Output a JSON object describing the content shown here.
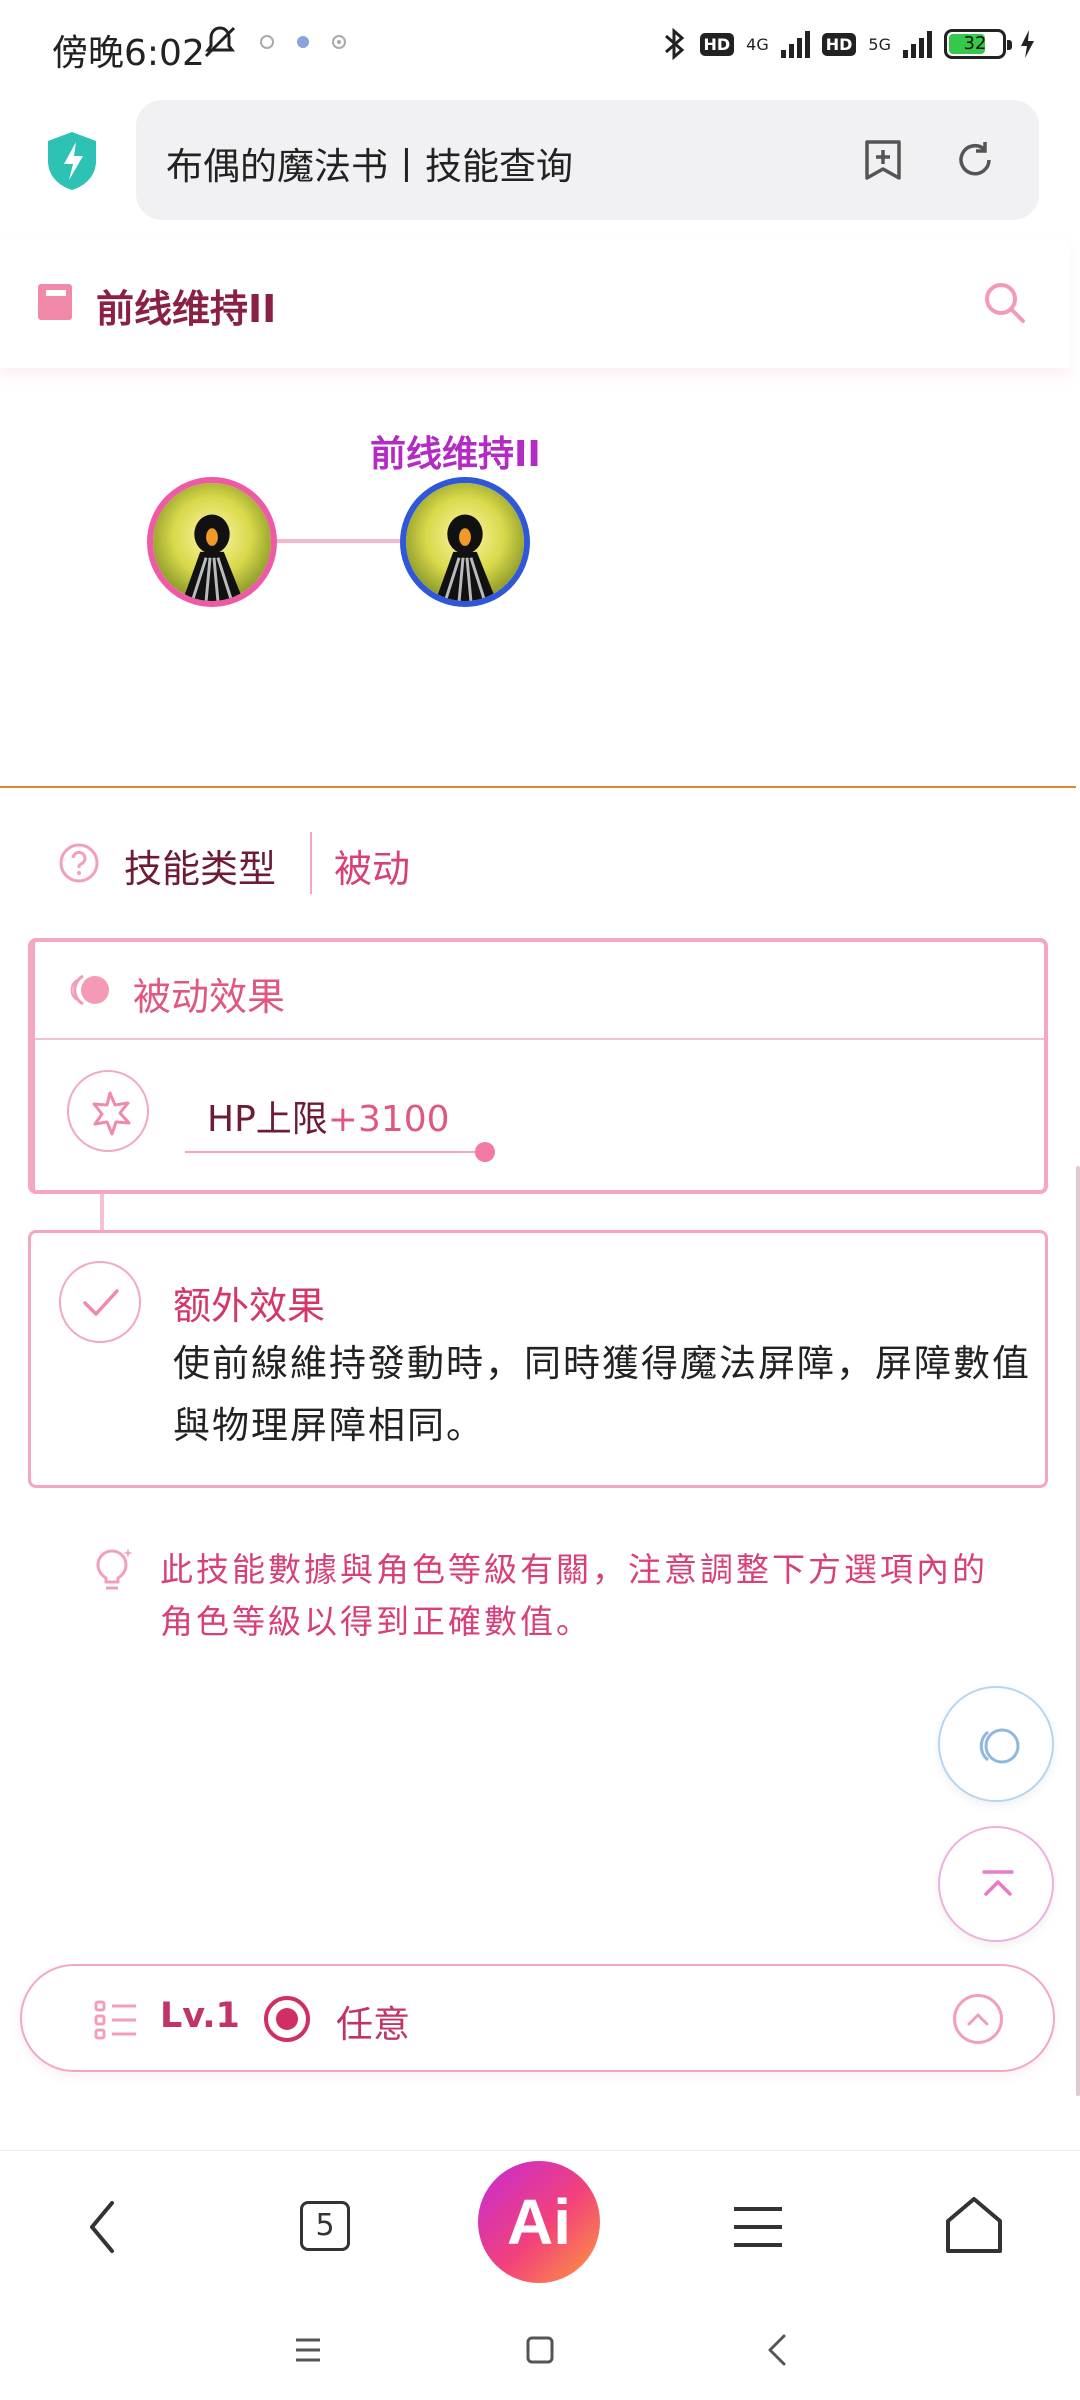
{
  "status_bar": {
    "time": "傍晚6:02",
    "net1": "4G",
    "net2": "5G",
    "hd1": "HD",
    "hd2": "HD",
    "battery": "32"
  },
  "browser": {
    "address_text": "布偶的魔法书丨技能查询"
  },
  "page": {
    "header_title": "前线维持II"
  },
  "skill_tree": {
    "current_label": "前线维持II"
  },
  "skill_type": {
    "label": "技能类型",
    "value": "被动"
  },
  "passive": {
    "title": "被动效果",
    "stat_label": "HP上限",
    "stat_value": "+3100"
  },
  "extra": {
    "title": "额外效果",
    "description": "使前線維持發動時，同時獲得魔法屏障，屏障數值與物理屏障相同。"
  },
  "note": {
    "text": "此技能數據與角色等級有關，注意調整下方選項內的角色等級以得到正確數值。"
  },
  "level_bar": {
    "level": "Lv.1",
    "option": "任意"
  },
  "bottom_nav": {
    "tab_count": "5",
    "ai_label": "Ai"
  },
  "colors": {
    "accent": "#e0577f",
    "dark_text": "#6e1b34",
    "tree_label": "#b32bc4",
    "node1_ring": "#ee5aa6",
    "node2_ring": "#2f57d8"
  }
}
